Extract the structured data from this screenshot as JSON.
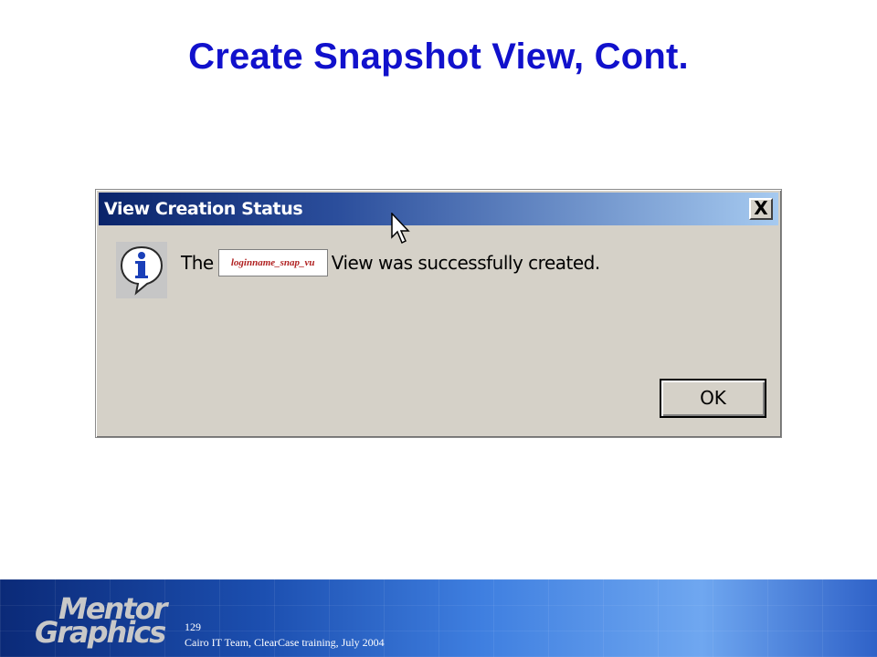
{
  "slide": {
    "title": "Create Snapshot View, Cont."
  },
  "dialog": {
    "title": "View Creation Status",
    "close_label": "X",
    "message_prefix": "The",
    "view_name": "loginname_snap_vu",
    "message_suffix": "View was successfully created.",
    "ok_label": "OK",
    "icon": "info-icon"
  },
  "footer": {
    "page_number": "129",
    "credit": "Cairo IT Team, ClearCase training, July 2004",
    "logo_line1": "Mentor",
    "logo_line2": "Graphics"
  },
  "colors": {
    "title": "#1111cc",
    "titlebar_start": "#0a246a",
    "titlebar_end": "#a6caf0",
    "dialog_face": "#d5d1c8",
    "view_name_text": "#b02020"
  }
}
